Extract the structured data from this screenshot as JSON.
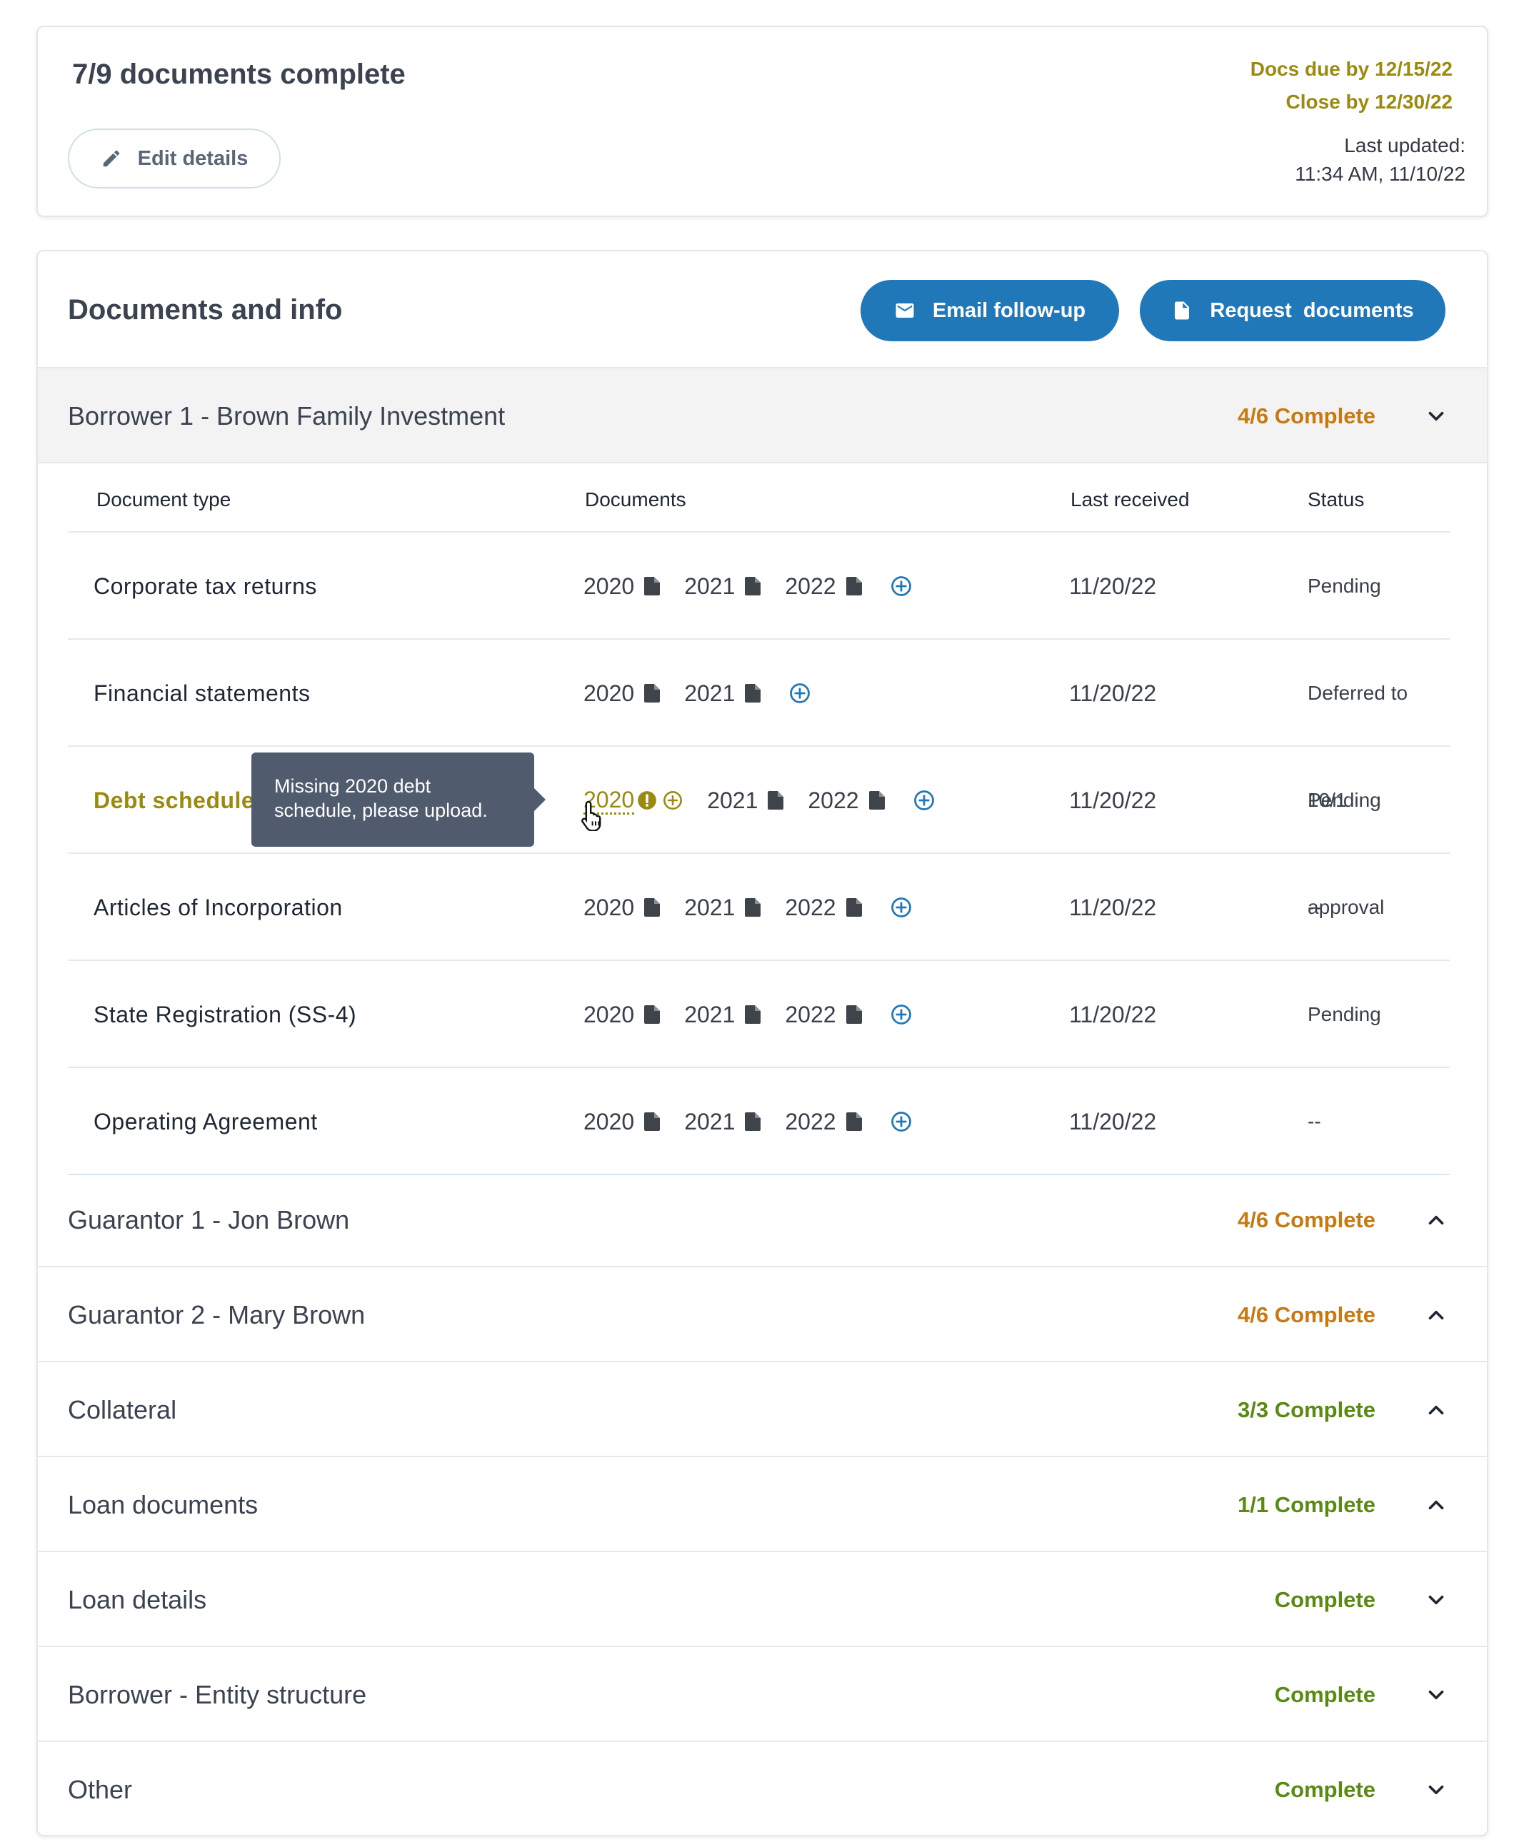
{
  "summary": {
    "title": "7/9 documents complete",
    "edit_label": "Edit details",
    "docs_due": "Docs due by 12/15/22",
    "close_by": "Close by 12/30/22",
    "last_updated_label": "Last updated:",
    "last_updated_value": "11:34 AM, 11/10/22"
  },
  "docs": {
    "title": "Documents and info",
    "email_label": "Email follow-up",
    "request_label": "Request  documents"
  },
  "colors": {
    "accent_blue": "#2178b9",
    "warning_gold": "#9a8a12",
    "partial_orange": "#c77a12",
    "complete_green": "#5a8a14"
  },
  "borrower": {
    "label": "Borrower 1 - Brown Family Investment",
    "status": "4/6 Complete"
  },
  "table": {
    "headers": {
      "type": "Document type",
      "documents": "Documents",
      "received": "Last received",
      "status": "Status"
    },
    "rows": [
      {
        "type": "Corporate tax returns",
        "years": [
          "2020",
          "2021",
          "2022"
        ],
        "received": "11/20/22",
        "status": "Pending"
      },
      {
        "type": "Financial statements",
        "years": [
          "2020",
          "2021"
        ],
        "received": "11/20/22",
        "status": "Deferred to 10/1"
      },
      {
        "type": "Debt schedule",
        "years": [
          "2020",
          "2021",
          "2022"
        ],
        "received": "11/20/22",
        "status": "Pending approval"
      },
      {
        "type": "Articles of Incorporation",
        "years": [
          "2020",
          "2021",
          "2022"
        ],
        "received": "11/20/22",
        "status": "--"
      },
      {
        "type": "State Registration (SS-4)",
        "years": [
          "2020",
          "2021",
          "2022"
        ],
        "received": "11/20/22",
        "status": "Pending"
      },
      {
        "type": "Operating Agreement",
        "years": [
          "2020",
          "2021",
          "2022"
        ],
        "received": "11/20/22",
        "status": "--"
      }
    ]
  },
  "tooltip": {
    "line1": "Missing 2020 debt",
    "line2": "schedule, please upload."
  },
  "sections": [
    {
      "label": "Guarantor 1 - Jon Brown",
      "status": "4/6 Complete",
      "chevron": "chevron-up-icon"
    },
    {
      "label": "Guarantor 2 - Mary Brown",
      "status": "4/6 Complete",
      "chevron": "chevron-up-icon"
    },
    {
      "label": "Collateral",
      "status": "3/3 Complete",
      "chevron": "chevron-up-icon"
    },
    {
      "label": "Loan documents",
      "status": "1/1 Complete",
      "chevron": "chevron-up-icon"
    },
    {
      "label": "Loan details",
      "status": "Complete",
      "chevron": "chevron-down-icon"
    },
    {
      "label": "Borrower - Entity structure",
      "status": "Complete",
      "chevron": "chevron-down-icon"
    },
    {
      "label": "Other",
      "status": "Complete",
      "chevron": "chevron-down-icon"
    }
  ]
}
